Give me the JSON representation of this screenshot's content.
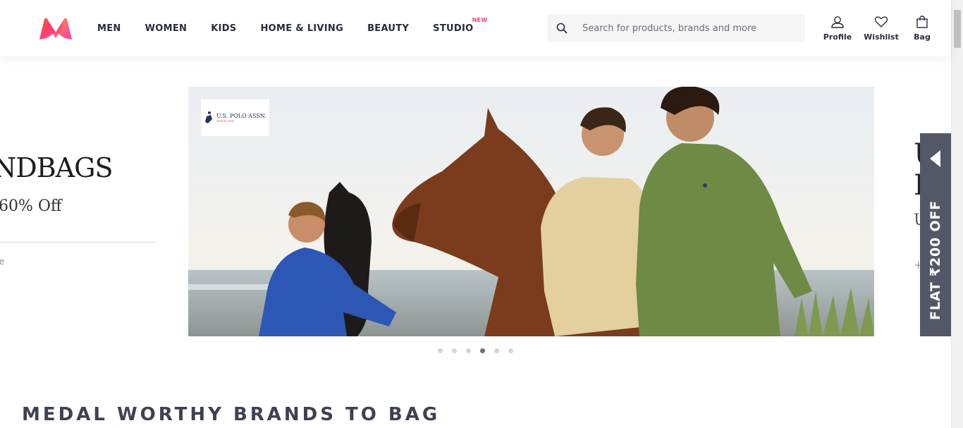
{
  "header": {
    "logo_icon": "myntra-logo",
    "nav": [
      {
        "label": "MEN"
      },
      {
        "label": "WOMEN"
      },
      {
        "label": "KIDS"
      },
      {
        "label": "HOME & LIVING"
      },
      {
        "label": "BEAUTY"
      },
      {
        "label": "STUDIO",
        "badge": "NEW"
      }
    ],
    "search": {
      "placeholder": "Search for products, brands and more",
      "value": "",
      "icon": "search-icon"
    },
    "actions": [
      {
        "label": "Profile",
        "icon": "user-icon"
      },
      {
        "label": "Wishlist",
        "icon": "heart-icon"
      },
      {
        "label": "Bag",
        "icon": "bag-icon"
      }
    ]
  },
  "carousel": {
    "prev_slide": {
      "title": "NDBAGS",
      "subtitle": "60% Off",
      "link": "re"
    },
    "current_slide": {
      "brand_name": "U.S. POLO ASSN.",
      "brand_since": "SINCE 1890"
    },
    "next_slide_chars": [
      "U",
      "D",
      "U",
      "+"
    ],
    "dots_count": 6,
    "active_dot_index": 3
  },
  "offer_tab": {
    "text": "FLAT ₹200 OFF",
    "icon": "chevron-left-icon"
  },
  "section": {
    "title": "MEDAL WORTHY BRANDS TO BAG"
  },
  "colors": {
    "accent": "#ff3f6c",
    "text": "#282c3f",
    "offer_bg": "#535766"
  }
}
